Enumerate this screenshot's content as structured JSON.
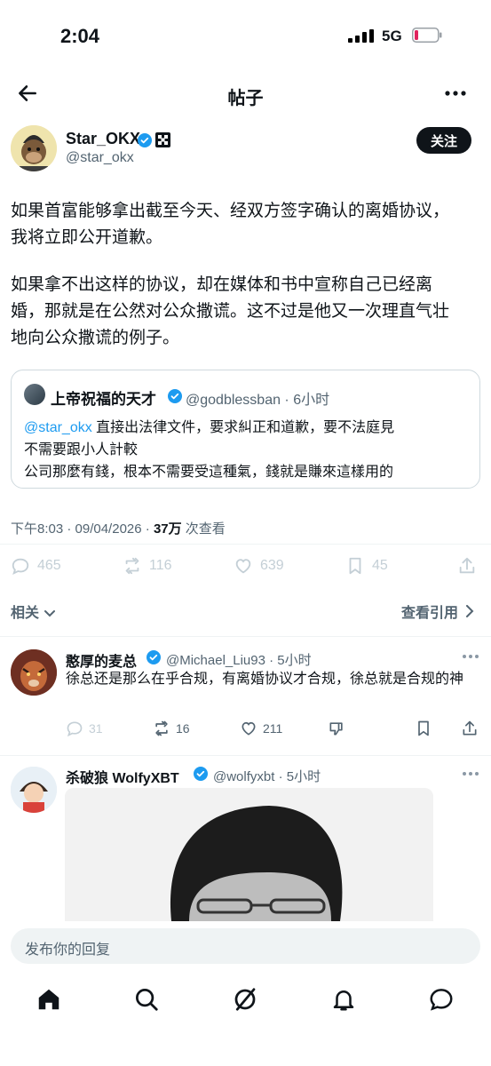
{
  "status": {
    "time": "2:04",
    "network": "5G"
  },
  "header": {
    "title": "帖子"
  },
  "author": {
    "name": "Star_OKX",
    "handle": "@star_okx",
    "follow_label": "关注"
  },
  "post": {
    "lines": [
      "如果首富能够拿出截至今天、经双方签字确认的离婚协议，",
      "我将立即公开道歉。",
      "如果拿不出这样的协议，却在媒体和书中宣称自己已经离",
      "婚，那就是在公然对公众撒谎。这不过是他又一次理直气壮",
      "地向公众撒谎的例子。"
    ]
  },
  "quote": {
    "name": "上帝祝福的天才",
    "meta": "@godblessban · 6小时",
    "mention": "@star_okx",
    "line1_rest": " 直接出法律文件，要求糾正和道歉，要不法庭見",
    "line2": "不需要跟小人計較",
    "line3": "公司那麼有錢，根本不需要受這種氣，錢就是賺來這樣用的"
  },
  "meta": {
    "time_date": "下午8:03 · 09/04/2026 · ",
    "views": "37万",
    "views_label": " 次查看"
  },
  "actions": {
    "replies": "465",
    "reposts": "116",
    "likes": "639",
    "bookmarks": "45"
  },
  "related": {
    "left": "相关",
    "right": "查看引用"
  },
  "replies": [
    {
      "name": "憨厚的麦总",
      "meta": "@Michael_Liu93 · 5小时",
      "text": "徐总还是那么在乎合规，有离婚协议才合规，徐总就是合规的神",
      "replies": "31",
      "reposts": "16",
      "likes": "211"
    },
    {
      "name": "杀破狼 WolfyXBT",
      "meta": "@wolfyxbt · 5小时"
    }
  ],
  "reply_bar": {
    "placeholder": "发布你的回复"
  },
  "icons": [
    "back-arrow-icon",
    "more-icon",
    "verified-icon",
    "grid-icon",
    "reply-icon",
    "repost-icon",
    "like-icon",
    "bookmark-icon",
    "share-icon",
    "dislike-icon",
    "home-icon",
    "search-icon",
    "grok-icon",
    "bell-icon",
    "messages-icon"
  ],
  "colors": {
    "accent": "#1d9bf0",
    "text": "#0f1419",
    "muted": "#536471",
    "border": "#cfd9de"
  }
}
